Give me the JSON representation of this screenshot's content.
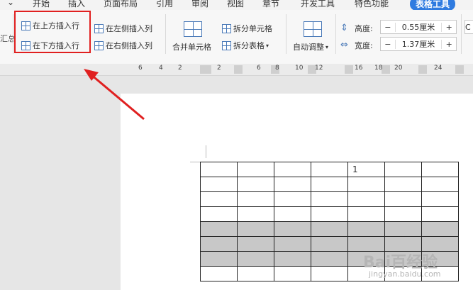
{
  "tabs": [
    "开始",
    "插入",
    "页面布局",
    "引用",
    "审阅",
    "视图",
    "章节",
    "开发工具",
    "特色功能",
    "表格工具"
  ],
  "ribbon": {
    "left_clip": "汇总",
    "insert_above": "在上方插入行",
    "insert_below": "在下方插入行",
    "insert_left": "在左侧插入列",
    "insert_right": "在右侧插入列",
    "merge_cells": "合并单元格",
    "split_cells": "拆分单元格",
    "split_table": "拆分表格",
    "auto_fit": "自动调整",
    "height_label": "高度:",
    "height_value": "0.55厘米",
    "width_label": "宽度:",
    "width_value": "1.37厘米",
    "minus": "−",
    "plus": "+",
    "right_clip": "C"
  },
  "ruler": {
    "ticks": [
      "6",
      "4",
      "2",
      "2",
      "6",
      "8",
      "10",
      "12",
      "16",
      "18",
      "20",
      "24"
    ]
  },
  "table": {
    "first_row": [
      "",
      "",
      "",
      "",
      "1",
      "",
      ""
    ]
  },
  "watermark": {
    "logo": "Bai百经验",
    "sub": "jingyan.baidu.com"
  },
  "colors": {
    "accent": "#2f7be0",
    "highlight": "#e02020",
    "shaded_row": "#c8c8c8"
  }
}
